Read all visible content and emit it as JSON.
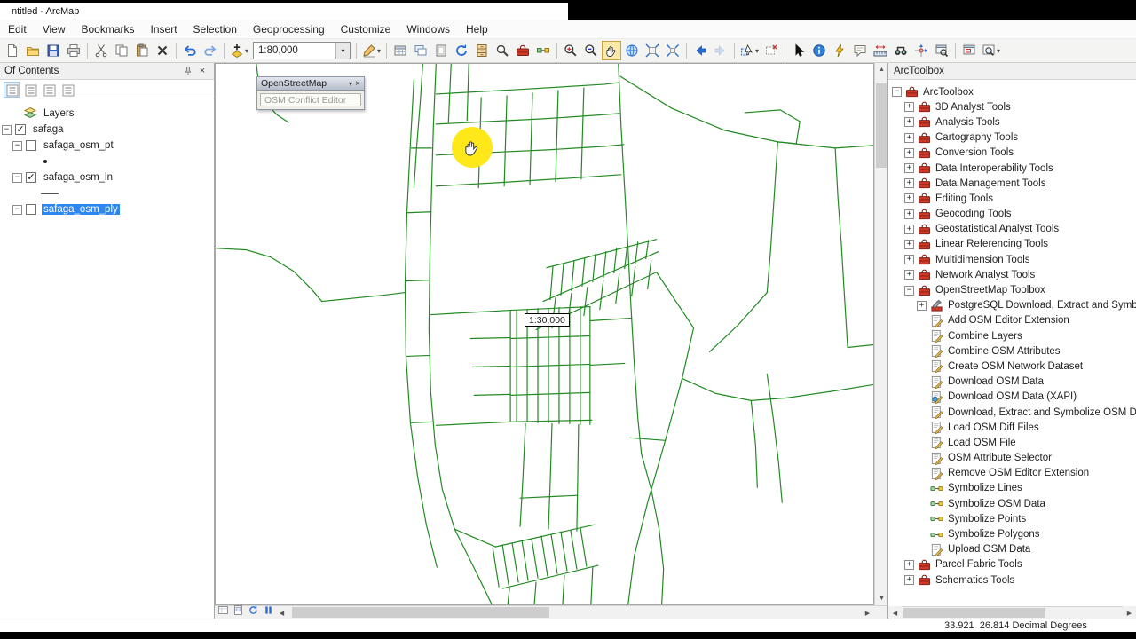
{
  "window": {
    "title": "ntitled - ArcMap"
  },
  "menu": {
    "items": [
      "Edit",
      "View",
      "Bookmarks",
      "Insert",
      "Selection",
      "Geoprocessing",
      "Customize",
      "Windows",
      "Help"
    ]
  },
  "toolbar": {
    "items": [
      {
        "type": "icon",
        "name": "new-document"
      },
      {
        "type": "icon",
        "name": "open-folder"
      },
      {
        "type": "icon",
        "name": "save"
      },
      {
        "type": "icon",
        "name": "print"
      },
      {
        "type": "sep"
      },
      {
        "type": "icon",
        "name": "cut"
      },
      {
        "type": "icon",
        "name": "copy"
      },
      {
        "type": "icon",
        "name": "paste"
      },
      {
        "type": "icon",
        "name": "delete-x"
      },
      {
        "type": "sep"
      },
      {
        "type": "icon",
        "name": "undo"
      },
      {
        "type": "icon",
        "name": "redo"
      },
      {
        "type": "sep"
      },
      {
        "type": "icon",
        "name": "add-data",
        "caret": true
      },
      {
        "type": "combo",
        "name": "map-scale-combo",
        "value": "1:80,000"
      },
      {
        "type": "sep"
      },
      {
        "type": "icon",
        "name": "editor-pencil",
        "caret": true
      },
      {
        "type": "sep"
      },
      {
        "type": "icon",
        "name": "table"
      },
      {
        "type": "icon",
        "name": "data-frame"
      },
      {
        "type": "icon",
        "name": "layout"
      },
      {
        "type": "icon",
        "name": "refresh-map"
      },
      {
        "type": "icon",
        "name": "catalog"
      },
      {
        "type": "icon",
        "name": "search"
      },
      {
        "type": "icon",
        "name": "arctoolbox"
      },
      {
        "type": "icon",
        "name": "modelbuilder"
      },
      {
        "type": "sep"
      },
      {
        "type": "icon",
        "name": "zoom-in"
      },
      {
        "type": "icon",
        "name": "zoom-out"
      },
      {
        "type": "icon",
        "name": "pan",
        "active": true
      },
      {
        "type": "icon",
        "name": "full-extent"
      },
      {
        "type": "icon",
        "name": "fixed-zoom-in"
      },
      {
        "type": "icon",
        "name": "fixed-zoom-out"
      },
      {
        "type": "sep"
      },
      {
        "type": "icon",
        "name": "back"
      },
      {
        "type": "icon",
        "name": "forward",
        "disabled": true
      },
      {
        "type": "sep"
      },
      {
        "type": "icon",
        "name": "select-features",
        "caret": true
      },
      {
        "type": "icon",
        "name": "clear-selection"
      },
      {
        "type": "sep"
      },
      {
        "type": "icon",
        "name": "select-elements"
      },
      {
        "type": "icon",
        "name": "identify"
      },
      {
        "type": "icon",
        "name": "hyperlink"
      },
      {
        "type": "icon",
        "name": "html-popup"
      },
      {
        "type": "icon",
        "name": "measure"
      },
      {
        "type": "icon",
        "name": "find"
      },
      {
        "type": "icon",
        "name": "goto-xy"
      },
      {
        "type": "icon",
        "name": "viewer-window"
      },
      {
        "type": "sep"
      },
      {
        "type": "icon",
        "name": "overview-window"
      },
      {
        "type": "icon",
        "name": "magnifier-window",
        "caret": true
      }
    ]
  },
  "toc": {
    "header": "Of Contents",
    "tools": [
      "list-by-drawing-order",
      "list-by-source",
      "list-by-visibility",
      "list-by-selection"
    ],
    "rows": [
      {
        "kind": "dataframe",
        "label": "Layers",
        "indent": 26
      },
      {
        "kind": "layer",
        "label": "safaga",
        "indent": 2,
        "checked": true,
        "expand": "minus"
      },
      {
        "kind": "layer",
        "label": "safaga_osm_pt",
        "indent": 14,
        "checked": false,
        "expand": "minus"
      },
      {
        "kind": "symbol",
        "symbol": "point",
        "indent": 46
      },
      {
        "kind": "layer",
        "label": "safaga_osm_ln",
        "indent": 14,
        "checked": true,
        "expand": "minus"
      },
      {
        "kind": "symbol",
        "symbol": "line",
        "indent": 46
      },
      {
        "kind": "layer",
        "label": "safaga_osm_ply",
        "indent": 14,
        "checked": false,
        "expand": "minus",
        "selected": true
      },
      {
        "kind": "symbol",
        "symbol": "polygon",
        "indent": 46
      }
    ]
  },
  "map": {
    "osm_toolbar": {
      "title": "OpenStreetMap",
      "button": "OSM Conflict Editor"
    },
    "scale_tooltip": "1:30,000",
    "view_buttons": [
      "data-view",
      "layout-view",
      "refresh-view",
      "pause-drawing"
    ]
  },
  "toolbox": {
    "header": "ArcToolbox",
    "items": [
      {
        "label": "ArcToolbox",
        "icon": "toolbox",
        "level": 0,
        "expand": "minus"
      },
      {
        "label": "3D Analyst Tools",
        "icon": "toolbox",
        "level": 1,
        "expand": "plus"
      },
      {
        "label": "Analysis Tools",
        "icon": "toolbox",
        "level": 1,
        "expand": "plus"
      },
      {
        "label": "Cartography Tools",
        "icon": "toolbox",
        "level": 1,
        "expand": "plus"
      },
      {
        "label": "Conversion Tools",
        "icon": "toolbox",
        "level": 1,
        "expand": "plus"
      },
      {
        "label": "Data Interoperability Tools",
        "icon": "toolbox",
        "level": 1,
        "expand": "plus"
      },
      {
        "label": "Data Management Tools",
        "icon": "toolbox",
        "level": 1,
        "expand": "plus"
      },
      {
        "label": "Editing Tools",
        "icon": "toolbox",
        "level": 1,
        "expand": "plus"
      },
      {
        "label": "Geocoding Tools",
        "icon": "toolbox",
        "level": 1,
        "expand": "plus"
      },
      {
        "label": "Geostatistical Analyst Tools",
        "icon": "toolbox",
        "level": 1,
        "expand": "plus"
      },
      {
        "label": "Linear Referencing Tools",
        "icon": "toolbox",
        "level": 1,
        "expand": "plus"
      },
      {
        "label": "Multidimension Tools",
        "icon": "toolbox",
        "level": 1,
        "expand": "plus"
      },
      {
        "label": "Network Analyst Tools",
        "icon": "toolbox",
        "level": 1,
        "expand": "plus"
      },
      {
        "label": "OpenStreetMap Toolbox",
        "icon": "toolbox",
        "level": 1,
        "expand": "minus"
      },
      {
        "label": "PostgreSQL Download, Extract and Symbo",
        "icon": "toolset",
        "level": 2,
        "expand": "plus"
      },
      {
        "label": "Add OSM Editor Extension",
        "icon": "script",
        "level": 2
      },
      {
        "label": "Combine Layers",
        "icon": "script",
        "level": 2
      },
      {
        "label": "Combine OSM Attributes",
        "icon": "script",
        "level": 2
      },
      {
        "label": "Create OSM Network Dataset",
        "icon": "script",
        "level": 2
      },
      {
        "label": "Download OSM Data",
        "icon": "script",
        "level": 2
      },
      {
        "label": "Download OSM Data (XAPI)",
        "icon": "script-blue",
        "level": 2
      },
      {
        "label": "Download, Extract and Symbolize OSM Da",
        "icon": "script",
        "level": 2
      },
      {
        "label": "Load OSM Diff Files",
        "icon": "script",
        "level": 2
      },
      {
        "label": "Load OSM File",
        "icon": "script",
        "level": 2
      },
      {
        "label": "OSM Attribute Selector",
        "icon": "script",
        "level": 2
      },
      {
        "label": "Remove OSM Editor Extension",
        "icon": "script",
        "level": 2
      },
      {
        "label": "Symbolize Lines",
        "icon": "model",
        "level": 2
      },
      {
        "label": "Symbolize OSM Data",
        "icon": "model",
        "level": 2
      },
      {
        "label": "Symbolize Points",
        "icon": "model",
        "level": 2
      },
      {
        "label": "Symbolize Polygons",
        "icon": "model",
        "level": 2
      },
      {
        "label": "Upload OSM Data",
        "icon": "script",
        "level": 2
      },
      {
        "label": "Parcel Fabric Tools",
        "icon": "toolbox",
        "level": 1,
        "expand": "plus"
      },
      {
        "label": "Schematics Tools",
        "icon": "toolbox",
        "level": 1,
        "expand": "plus"
      }
    ]
  },
  "status": {
    "coordinates": "33.921  26.814 Decimal Degrees"
  },
  "colors": {
    "map_line": "#238a23",
    "selection_blue": "#2e86f0",
    "highlight_yellow": "#ffe81a"
  }
}
